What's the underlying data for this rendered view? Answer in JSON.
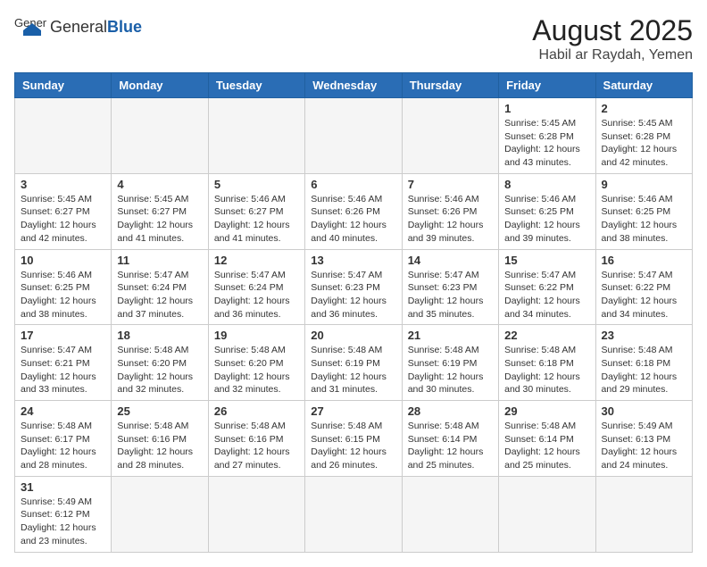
{
  "header": {
    "logo_general": "General",
    "logo_blue": "Blue",
    "title": "August 2025",
    "subtitle": "Habil ar Raydah, Yemen"
  },
  "weekdays": [
    "Sunday",
    "Monday",
    "Tuesday",
    "Wednesday",
    "Thursday",
    "Friday",
    "Saturday"
  ],
  "weeks": [
    [
      {
        "day": "",
        "info": ""
      },
      {
        "day": "",
        "info": ""
      },
      {
        "day": "",
        "info": ""
      },
      {
        "day": "",
        "info": ""
      },
      {
        "day": "",
        "info": ""
      },
      {
        "day": "1",
        "info": "Sunrise: 5:45 AM\nSunset: 6:28 PM\nDaylight: 12 hours and 43 minutes."
      },
      {
        "day": "2",
        "info": "Sunrise: 5:45 AM\nSunset: 6:28 PM\nDaylight: 12 hours and 42 minutes."
      }
    ],
    [
      {
        "day": "3",
        "info": "Sunrise: 5:45 AM\nSunset: 6:27 PM\nDaylight: 12 hours and 42 minutes."
      },
      {
        "day": "4",
        "info": "Sunrise: 5:45 AM\nSunset: 6:27 PM\nDaylight: 12 hours and 41 minutes."
      },
      {
        "day": "5",
        "info": "Sunrise: 5:46 AM\nSunset: 6:27 PM\nDaylight: 12 hours and 41 minutes."
      },
      {
        "day": "6",
        "info": "Sunrise: 5:46 AM\nSunset: 6:26 PM\nDaylight: 12 hours and 40 minutes."
      },
      {
        "day": "7",
        "info": "Sunrise: 5:46 AM\nSunset: 6:26 PM\nDaylight: 12 hours and 39 minutes."
      },
      {
        "day": "8",
        "info": "Sunrise: 5:46 AM\nSunset: 6:25 PM\nDaylight: 12 hours and 39 minutes."
      },
      {
        "day": "9",
        "info": "Sunrise: 5:46 AM\nSunset: 6:25 PM\nDaylight: 12 hours and 38 minutes."
      }
    ],
    [
      {
        "day": "10",
        "info": "Sunrise: 5:46 AM\nSunset: 6:25 PM\nDaylight: 12 hours and 38 minutes."
      },
      {
        "day": "11",
        "info": "Sunrise: 5:47 AM\nSunset: 6:24 PM\nDaylight: 12 hours and 37 minutes."
      },
      {
        "day": "12",
        "info": "Sunrise: 5:47 AM\nSunset: 6:24 PM\nDaylight: 12 hours and 36 minutes."
      },
      {
        "day": "13",
        "info": "Sunrise: 5:47 AM\nSunset: 6:23 PM\nDaylight: 12 hours and 36 minutes."
      },
      {
        "day": "14",
        "info": "Sunrise: 5:47 AM\nSunset: 6:23 PM\nDaylight: 12 hours and 35 minutes."
      },
      {
        "day": "15",
        "info": "Sunrise: 5:47 AM\nSunset: 6:22 PM\nDaylight: 12 hours and 34 minutes."
      },
      {
        "day": "16",
        "info": "Sunrise: 5:47 AM\nSunset: 6:22 PM\nDaylight: 12 hours and 34 minutes."
      }
    ],
    [
      {
        "day": "17",
        "info": "Sunrise: 5:47 AM\nSunset: 6:21 PM\nDaylight: 12 hours and 33 minutes."
      },
      {
        "day": "18",
        "info": "Sunrise: 5:48 AM\nSunset: 6:20 PM\nDaylight: 12 hours and 32 minutes."
      },
      {
        "day": "19",
        "info": "Sunrise: 5:48 AM\nSunset: 6:20 PM\nDaylight: 12 hours and 32 minutes."
      },
      {
        "day": "20",
        "info": "Sunrise: 5:48 AM\nSunset: 6:19 PM\nDaylight: 12 hours and 31 minutes."
      },
      {
        "day": "21",
        "info": "Sunrise: 5:48 AM\nSunset: 6:19 PM\nDaylight: 12 hours and 30 minutes."
      },
      {
        "day": "22",
        "info": "Sunrise: 5:48 AM\nSunset: 6:18 PM\nDaylight: 12 hours and 30 minutes."
      },
      {
        "day": "23",
        "info": "Sunrise: 5:48 AM\nSunset: 6:18 PM\nDaylight: 12 hours and 29 minutes."
      }
    ],
    [
      {
        "day": "24",
        "info": "Sunrise: 5:48 AM\nSunset: 6:17 PM\nDaylight: 12 hours and 28 minutes."
      },
      {
        "day": "25",
        "info": "Sunrise: 5:48 AM\nSunset: 6:16 PM\nDaylight: 12 hours and 28 minutes."
      },
      {
        "day": "26",
        "info": "Sunrise: 5:48 AM\nSunset: 6:16 PM\nDaylight: 12 hours and 27 minutes."
      },
      {
        "day": "27",
        "info": "Sunrise: 5:48 AM\nSunset: 6:15 PM\nDaylight: 12 hours and 26 minutes."
      },
      {
        "day": "28",
        "info": "Sunrise: 5:48 AM\nSunset: 6:14 PM\nDaylight: 12 hours and 25 minutes."
      },
      {
        "day": "29",
        "info": "Sunrise: 5:48 AM\nSunset: 6:14 PM\nDaylight: 12 hours and 25 minutes."
      },
      {
        "day": "30",
        "info": "Sunrise: 5:49 AM\nSunset: 6:13 PM\nDaylight: 12 hours and 24 minutes."
      }
    ],
    [
      {
        "day": "31",
        "info": "Sunrise: 5:49 AM\nSunset: 6:12 PM\nDaylight: 12 hours and 23 minutes."
      },
      {
        "day": "",
        "info": ""
      },
      {
        "day": "",
        "info": ""
      },
      {
        "day": "",
        "info": ""
      },
      {
        "day": "",
        "info": ""
      },
      {
        "day": "",
        "info": ""
      },
      {
        "day": "",
        "info": ""
      }
    ]
  ]
}
